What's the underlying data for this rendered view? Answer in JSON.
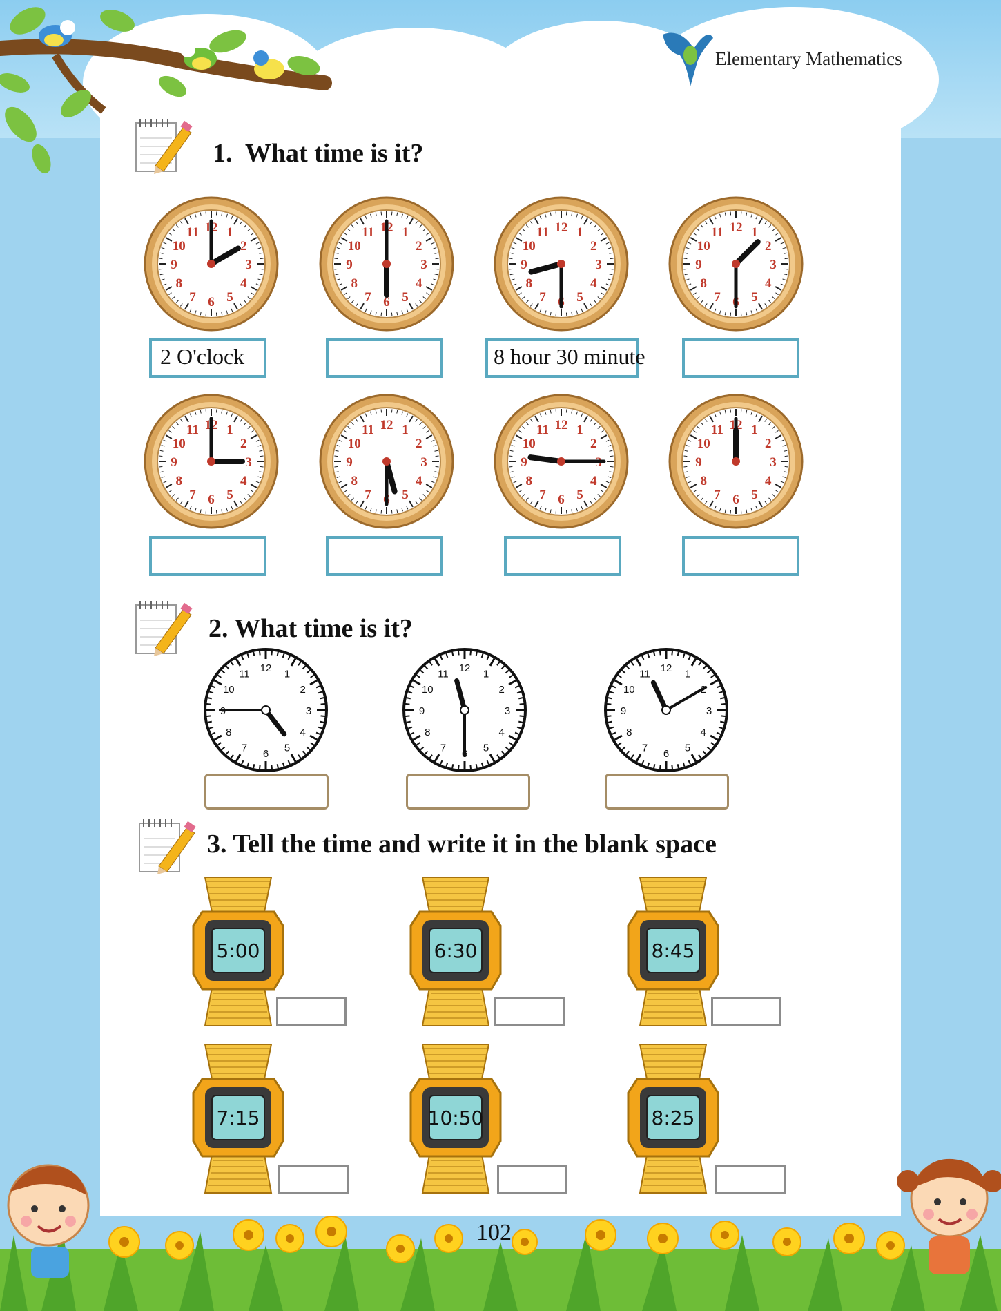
{
  "header": {
    "title": "Elementary Mathematics"
  },
  "sections": [
    {
      "number": "1.",
      "title": "What time is it?",
      "clocks": [
        {
          "hour": 2,
          "minute": 0
        },
        {
          "hour": 6,
          "minute": 0
        },
        {
          "hour": 8,
          "minute": 30
        },
        {
          "hour": 1,
          "minute": 30
        },
        {
          "hour": 3,
          "minute": 0
        },
        {
          "hour": 5,
          "minute": 30
        },
        {
          "hour": 9,
          "minute": 15
        },
        {
          "hour": 12,
          "minute": 0
        }
      ],
      "answers": [
        "2  O'clock",
        "",
        "8 hour 30 minute",
        "",
        "",
        "",
        "",
        ""
      ]
    },
    {
      "number": "2.",
      "title": "What time is it?",
      "clocks": [
        {
          "hour": 4,
          "minute": 45
        },
        {
          "hour": 11,
          "minute": 30
        },
        {
          "hour": 11,
          "minute": 10
        }
      ],
      "answers": [
        "",
        "",
        ""
      ]
    },
    {
      "number": "3.",
      "title": "Tell the time and write it in the blank space",
      "watches": [
        "5:00",
        "6:30",
        "8:45",
        "7:15",
        "10:50",
        "8:25"
      ],
      "answers": [
        "",
        "",
        "",
        "",
        "",
        ""
      ]
    }
  ],
  "footer": {
    "page_number": "102"
  },
  "colors": {
    "box_border": "#5aa9c0",
    "clock_rim": "#c8964a",
    "watch_gold": "#f2a51a",
    "watch_screen": "#8fd6d6"
  }
}
